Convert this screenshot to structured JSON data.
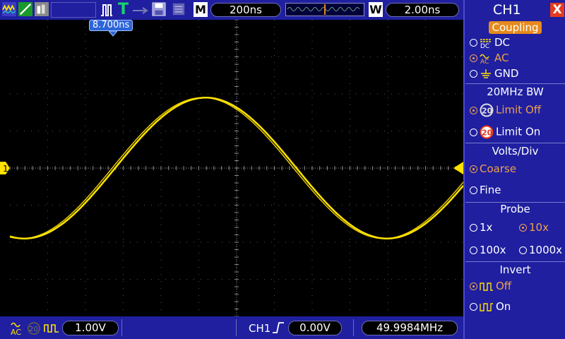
{
  "top_bar": {
    "mode_label": "M",
    "timebase": "200ns",
    "window_label": "W",
    "window_value": "2.00ns",
    "trigger_status": "T"
  },
  "trigger_position_marker": "8.700ns",
  "channel_marker": "1",
  "bottom_bar": {
    "ch1_scale": "1.00V",
    "trigger_source": "CH1",
    "trigger_level": "0.00V",
    "frequency": "49.9984MHz"
  },
  "side_menu": {
    "title": "CH1",
    "close_icon": "X",
    "coupling": {
      "title": "Coupling",
      "options": [
        {
          "label": "DC",
          "selected": false
        },
        {
          "label": "AC",
          "selected": true
        },
        {
          "label": "GND",
          "selected": false
        }
      ]
    },
    "bw_limit": {
      "title": "20MHz BW",
      "options": [
        {
          "label": "Limit Off",
          "badge": "20",
          "selected": true
        },
        {
          "label": "Limit On",
          "badge": "20",
          "selected": false
        }
      ]
    },
    "volts_div": {
      "title": "Volts/Div",
      "options": [
        {
          "label": "Coarse",
          "selected": true
        },
        {
          "label": "Fine",
          "selected": false
        }
      ]
    },
    "probe": {
      "title": "Probe",
      "options": [
        {
          "label": "1x",
          "selected": false
        },
        {
          "label": "10x",
          "selected": true
        },
        {
          "label": "100x",
          "selected": false
        },
        {
          "label": "1000x",
          "selected": false
        }
      ]
    },
    "invert": {
      "title": "Invert",
      "options": [
        {
          "label": "Off",
          "selected": true
        },
        {
          "label": "On",
          "selected": false
        }
      ]
    }
  },
  "colors": {
    "bar_blue": "#1f1fa0",
    "trace_yellow": "#ffe200",
    "selected_orange": "#f0a04a",
    "close_red": "#e43a1c"
  },
  "waveform": {
    "type": "sine",
    "cycles_on_screen": 1.25,
    "amplitude_divs": 2.0
  }
}
